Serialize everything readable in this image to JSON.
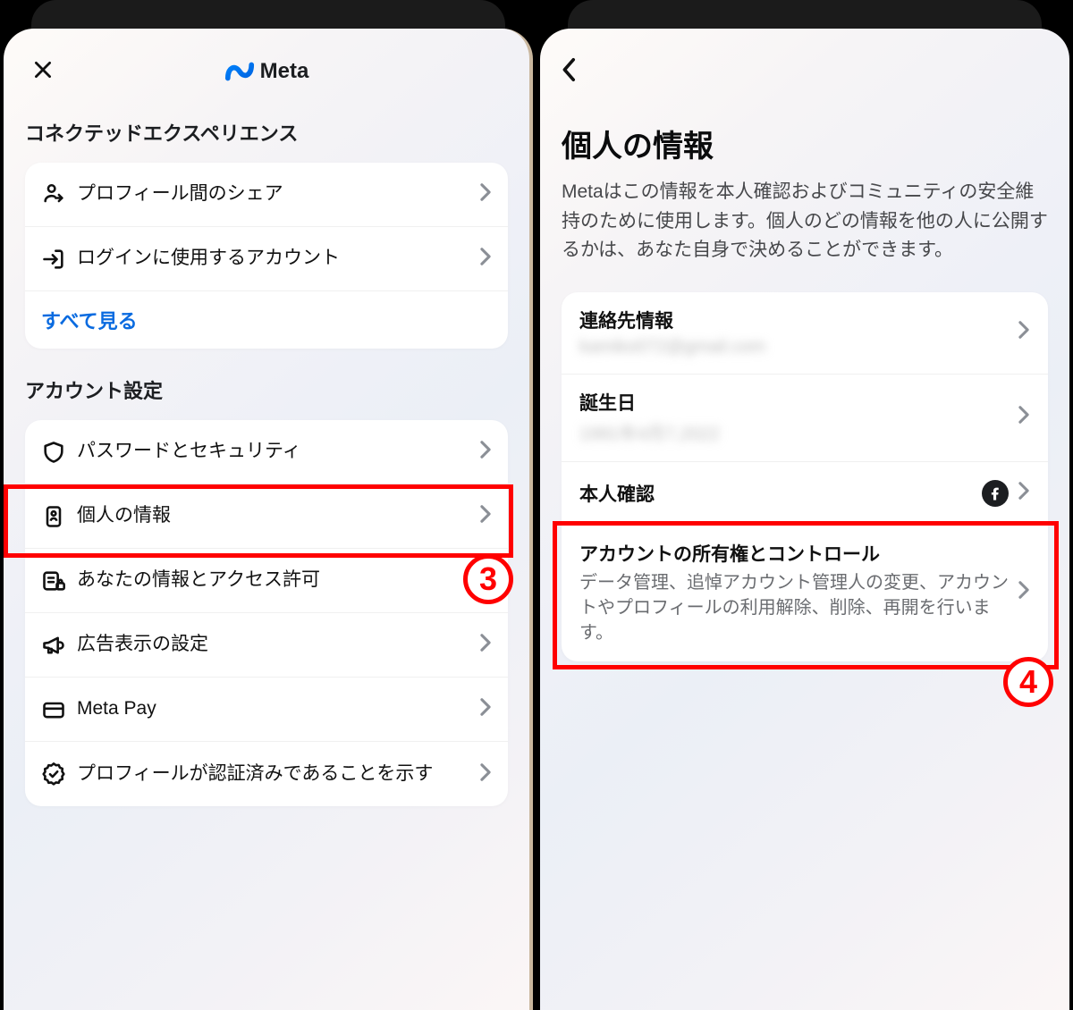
{
  "brand": "Meta",
  "left": {
    "section1_title": "コネクテッドエクスペリエンス",
    "items1": [
      {
        "icon": "share-profile-icon",
        "label": "プロフィール間のシェア"
      },
      {
        "icon": "login-account-icon",
        "label": "ログインに使用するアカウント"
      }
    ],
    "see_all": "すべて見る",
    "section2_title": "アカウント設定",
    "items2": [
      {
        "icon": "shield-icon",
        "label": "パスワードとセキュリティ"
      },
      {
        "icon": "id-card-icon",
        "label": "個人の情報"
      },
      {
        "icon": "access-icon",
        "label": "あなたの情報とアクセス許可"
      },
      {
        "icon": "megaphone-icon",
        "label": "広告表示の設定"
      },
      {
        "icon": "card-icon",
        "label": "Meta Pay"
      },
      {
        "icon": "verified-icon",
        "label": "プロフィールが認証済みであることを示す"
      }
    ]
  },
  "right": {
    "title": "個人の情報",
    "desc": "Metaはこの情報を本人確認およびコミュニティの安全維持のために使用します。個人のどの情報を他の人に公開するかは、あなた自身で決めることができます。",
    "rows": [
      {
        "label": "連絡先情報",
        "sub_blur": "kamiko072@gmail.com"
      },
      {
        "label": "誕生日",
        "sub_blur": "1991年4月7,2022"
      },
      {
        "label": "本人確認",
        "fb": true
      },
      {
        "label": "アカウントの所有権とコントロール",
        "desc": "データ管理、追悼アカウント管理人の変更、アカウントやプロフィールの利用解除、削除、再開を行います。"
      }
    ]
  },
  "annotations": {
    "left_badge": "3",
    "right_badge": "4"
  }
}
